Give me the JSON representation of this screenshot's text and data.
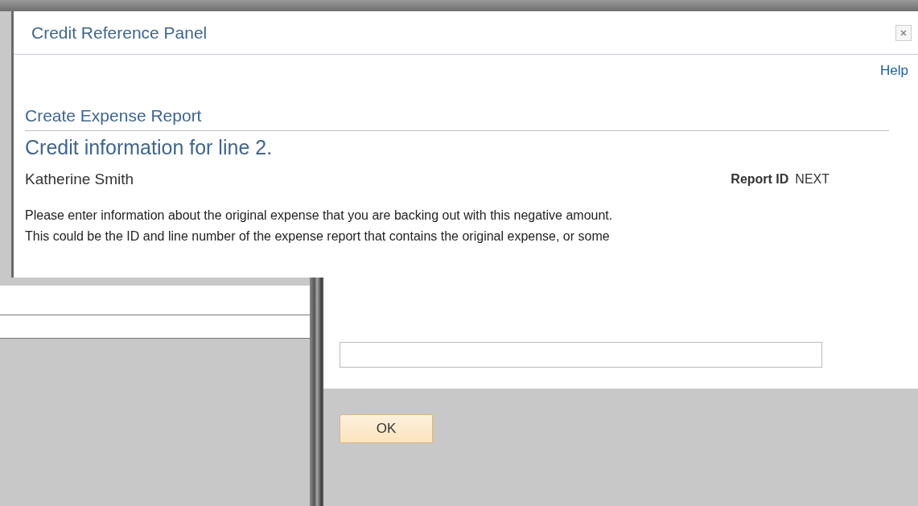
{
  "window": {
    "title": "Credit Reference Panel"
  },
  "help_link": "Help",
  "page_title": "Create Expense Report",
  "heading": "Credit information for line 2.",
  "employee_name": "Katherine Smith",
  "report_id": {
    "label": "Report ID",
    "value": "NEXT"
  },
  "instructions": [
    "Please enter information about the original expense that you are backing out with this negative amount.",
    "This could be the ID and line number of the expense report that contains the original expense, or some"
  ],
  "buttons": [
    {
      "label": "OK"
    }
  ]
}
